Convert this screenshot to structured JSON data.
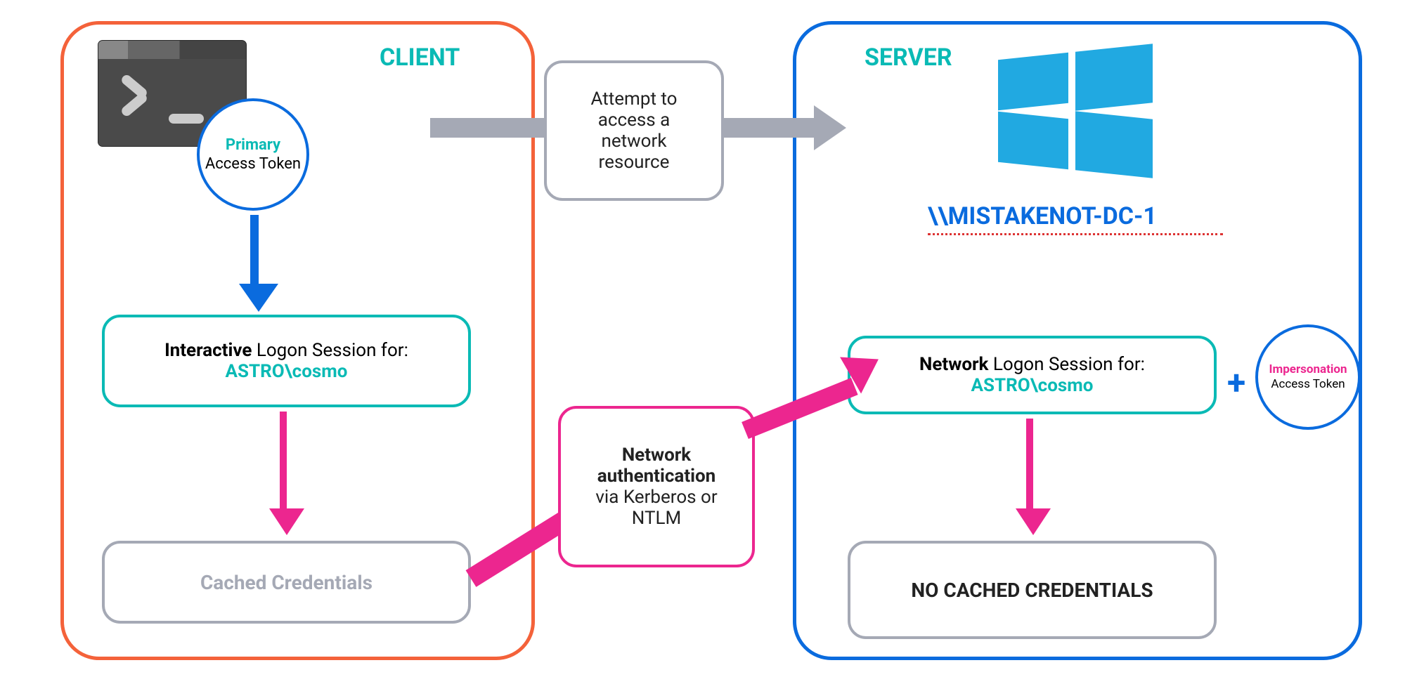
{
  "client": {
    "title": "CLIENT",
    "primary_token": {
      "highlight": "Primary",
      "rest": "Access Token"
    },
    "session": {
      "bold": "Interactive",
      "rest": " Logon Session for: ",
      "user": "ASTRO\\cosmo"
    },
    "cached": "Cached Credentials"
  },
  "server": {
    "title": "SERVER",
    "name": "\\\\MISTAKENOT-DC-1",
    "session": {
      "bold": "Network",
      "rest": " Logon Session for:",
      "user": "ASTRO\\cosmo"
    },
    "no_cache": "NO CACHED CREDENTIALS",
    "impersonation_token": {
      "highlight": "Impersonation",
      "rest": "Access Token"
    },
    "plus": "+"
  },
  "flow": {
    "attempt": "Attempt to access a network resource",
    "netauth": {
      "bold": "Network authentication",
      "rest": "via Kerberos or NTLM"
    }
  },
  "colors": {
    "orange": "#F4623A",
    "blue": "#0A6BDE",
    "teal": "#0ABAB5",
    "pink": "#EC268F",
    "grey": "#A5A9B5",
    "winblue": "#21A9E1"
  }
}
